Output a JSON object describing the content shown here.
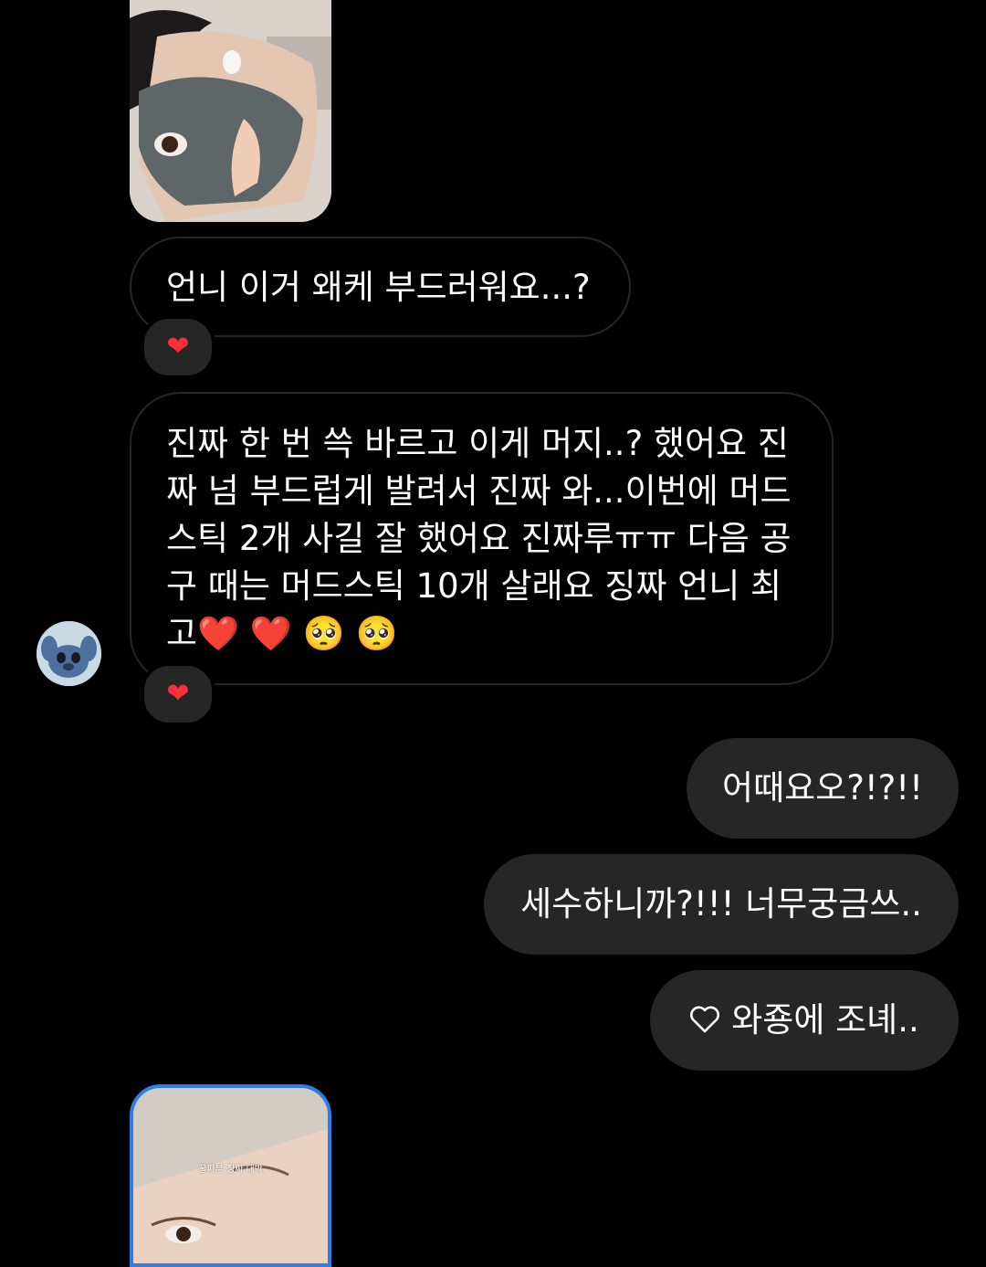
{
  "chat": {
    "messages": {
      "msg1": "언니 이거 왜케 부드러워요...?",
      "msg2": "진짜 한 번 쓱 바르고 이게 머지..? 했어요 진\n짜 넘 부드럽게 발려서 진짜 와...이번에 머드\n스틱 2개 사길 잘 했어요 진짜루ㅠㅠ 다음 공\n구 때는 머드스틱 10개 살래요 징짜 언니 최\n고❤️ ❤️ 🥺 🥺",
      "out1": "어때요오?!?!!",
      "out2": "세수하니까?!!! 너무궁금쓰..",
      "out3": "와죵에 조녜.."
    },
    "reactions": {
      "msg1_reaction": "❤",
      "msg2_reaction": "❤"
    },
    "photo_bottom_caption": "꿀피부 징짜 대박"
  },
  "colors": {
    "background": "#000000",
    "incoming_bubble_border": "#262626",
    "outgoing_bubble": "#262626",
    "heart": "#ff2f3a",
    "story_ring": "#2d7ee6"
  }
}
